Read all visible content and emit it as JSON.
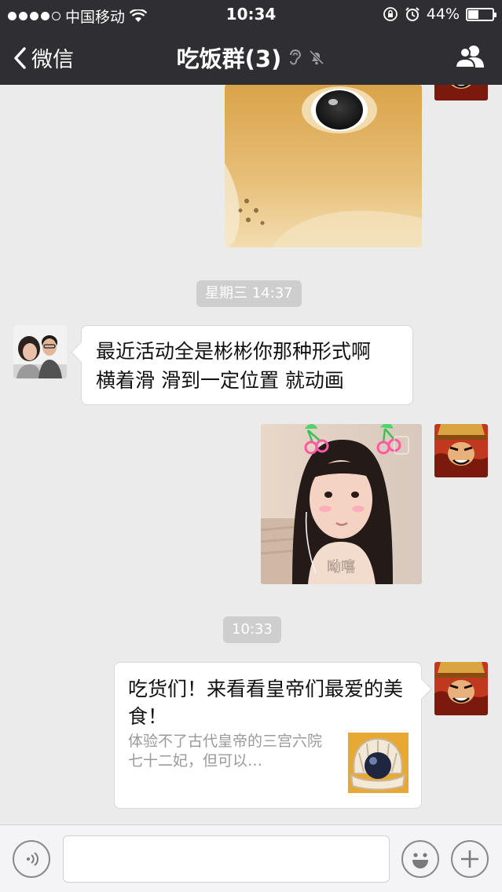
{
  "status_bar": {
    "carrier": "中国移动",
    "time": "10:34",
    "battery_percent_label": "44%",
    "battery_level": 0.44,
    "signal_bars_filled": 4,
    "signal_bars_total": 5
  },
  "nav": {
    "back_label": "微信",
    "title": "吃饭群(3)",
    "icons": [
      "chevron-left-icon",
      "ear-icon",
      "mute-bell-icon",
      "group-members-icon"
    ]
  },
  "messages": [
    {
      "type": "image",
      "side": "right",
      "subject": "shiba-dog-closeup"
    },
    {
      "type": "time",
      "text": "星期三 14:37"
    },
    {
      "type": "text",
      "side": "left",
      "lines": [
        "最近活动全是彬彬你那种形式啊",
        "横着滑 滑到一定位置 就动画"
      ]
    },
    {
      "type": "image",
      "side": "right",
      "subject": "girl-selfie-with-cherry-stickers",
      "caption": "呦嘻"
    },
    {
      "type": "time",
      "text": "10:33"
    },
    {
      "type": "link-card",
      "side": "right",
      "title": "吃货们！来看看皇帝们最爱的美食！",
      "description": "体验不了古代皇帝的三宫六院七十二妃，但可以…",
      "thumb_icon": "pearl-shell-icon"
    }
  ],
  "input_bar": {
    "placeholder": "",
    "icons": [
      "voice-icon",
      "emoji-icon",
      "plus-icon"
    ]
  },
  "colors": {
    "bar_bg": "#2e2e33",
    "chat_bg": "#ebebeb",
    "bubble_bg": "#ffffff",
    "time_pill": "#cecece"
  }
}
